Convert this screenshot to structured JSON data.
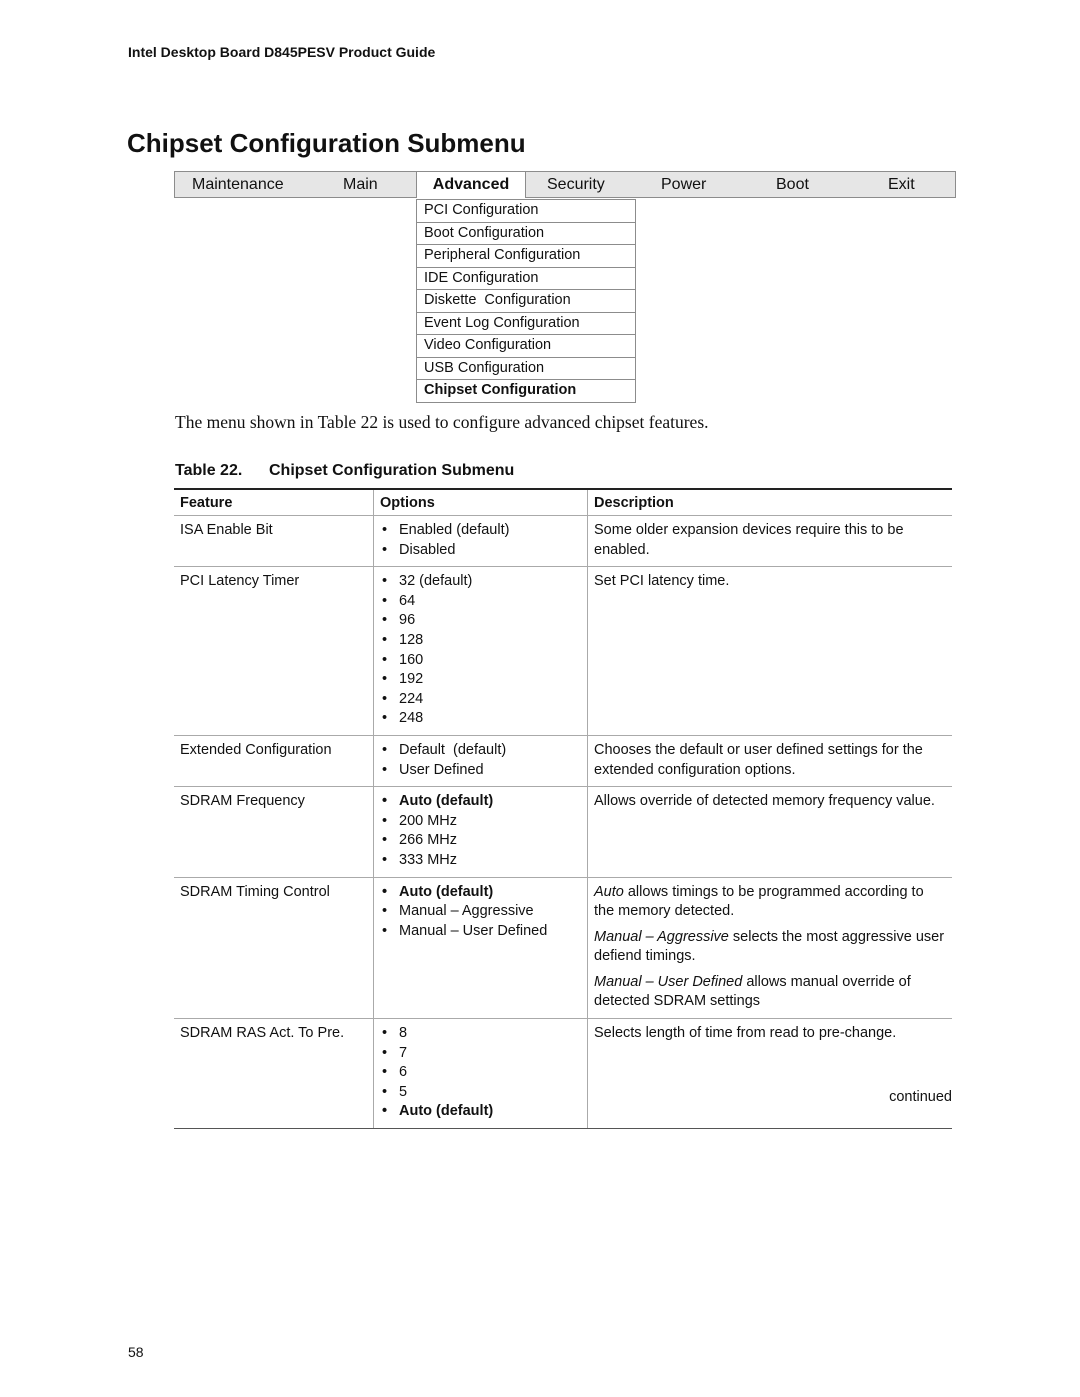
{
  "running_header": "Intel Desktop Board D845PESV Product Guide",
  "page_title": "Chipset Configuration Submenu",
  "menubar": {
    "tabs": [
      {
        "label": "Maintenance",
        "active": false
      },
      {
        "label": "Main",
        "active": false
      },
      {
        "label": "Advanced",
        "active": true
      },
      {
        "label": "Security",
        "active": false
      },
      {
        "label": "Power",
        "active": false
      },
      {
        "label": "Boot",
        "active": false
      },
      {
        "label": "Exit",
        "active": false
      }
    ]
  },
  "submenu": {
    "items": [
      {
        "label": "PCI Configuration",
        "current": false
      },
      {
        "label": "Boot Configuration",
        "current": false
      },
      {
        "label": "Peripheral Configuration",
        "current": false
      },
      {
        "label": "IDE Configuration",
        "current": false
      },
      {
        "label": "Diskette  Configuration",
        "current": false
      },
      {
        "label": "Event Log Configuration",
        "current": false
      },
      {
        "label": "Video Configuration",
        "current": false
      },
      {
        "label": "USB Configuration",
        "current": false
      },
      {
        "label": "Chipset Configuration",
        "current": true
      }
    ]
  },
  "intro_text": "The menu shown in Table 22 is used to configure advanced chipset features.",
  "table": {
    "caption_number": "Table 22.",
    "caption_title": "Chipset Configuration Submenu",
    "headers": {
      "feature": "Feature",
      "options": "Options",
      "description": "Description"
    },
    "rows": [
      {
        "feature": "ISA Enable Bit",
        "options": [
          {
            "text": "Enabled (default)"
          },
          {
            "text": "Disabled"
          }
        ],
        "description": [
          {
            "text": "Some older expansion devices require this to be enabled."
          }
        ]
      },
      {
        "feature": "PCI Latency Timer",
        "options": [
          {
            "text": "32 (default)"
          },
          {
            "text": "64"
          },
          {
            "text": "96"
          },
          {
            "text": "128"
          },
          {
            "text": "160"
          },
          {
            "text": "192"
          },
          {
            "text": "224"
          },
          {
            "text": "248"
          }
        ],
        "description": [
          {
            "text": "Set PCI latency time."
          }
        ]
      },
      {
        "feature": "Extended Configuration",
        "options": [
          {
            "text": "Default  (default)"
          },
          {
            "text": "User Defined"
          }
        ],
        "description": [
          {
            "text": "Chooses the default or user defined settings for the extended configuration options."
          }
        ]
      },
      {
        "feature": "SDRAM Frequency",
        "options": [
          {
            "text": "Auto (default)",
            "bold": true
          },
          {
            "text": "200 MHz"
          },
          {
            "text": "266 MHz"
          },
          {
            "text": "333 MHz"
          }
        ],
        "description": [
          {
            "text": "Allows override of detected memory frequency value."
          }
        ]
      },
      {
        "feature": "SDRAM Timing Control",
        "options": [
          {
            "text": "Auto (default)",
            "bold": true
          },
          {
            "text": "Manual – Aggressive"
          },
          {
            "text": "Manual – User Defined"
          }
        ],
        "description": [
          {
            "em": "Auto",
            "text": " allows timings to be programmed according to the memory detected."
          },
          {
            "em": "Manual – Aggressive",
            "text": " selects the most aggressive user defiend timings."
          },
          {
            "em": "Manual – User Defined",
            "text": " allows manual override of detected SDRAM settings"
          }
        ]
      },
      {
        "feature": "SDRAM RAS Act. To Pre.",
        "options": [
          {
            "text": "8"
          },
          {
            "text": "7"
          },
          {
            "text": "6"
          },
          {
            "text": "5"
          },
          {
            "text": "Auto (default)",
            "bold": true
          }
        ],
        "description": [
          {
            "text": "Selects length of time from read to pre-change."
          }
        ]
      }
    ]
  },
  "continued_label": "continued",
  "page_number": "58"
}
